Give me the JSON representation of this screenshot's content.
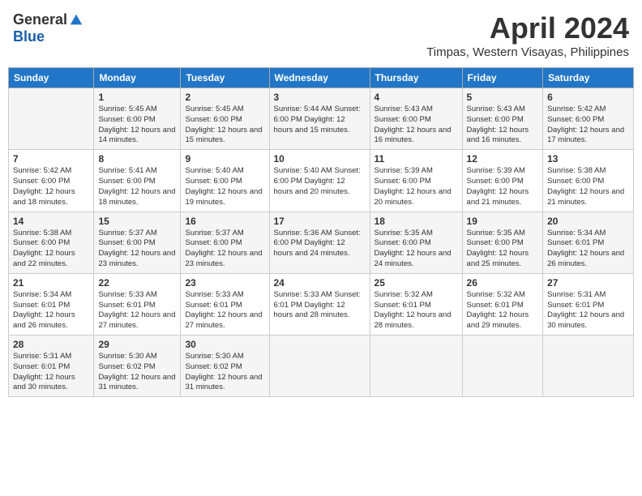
{
  "header": {
    "logo_general": "General",
    "logo_blue": "Blue",
    "title": "April 2024",
    "subtitle": "Timpas, Western Visayas, Philippines"
  },
  "days_of_week": [
    "Sunday",
    "Monday",
    "Tuesday",
    "Wednesday",
    "Thursday",
    "Friday",
    "Saturday"
  ],
  "weeks": [
    [
      {
        "day": "",
        "info": ""
      },
      {
        "day": "1",
        "info": "Sunrise: 5:45 AM\nSunset: 6:00 PM\nDaylight: 12 hours\nand 14 minutes."
      },
      {
        "day": "2",
        "info": "Sunrise: 5:45 AM\nSunset: 6:00 PM\nDaylight: 12 hours\nand 15 minutes."
      },
      {
        "day": "3",
        "info": "Sunrise: 5:44 AM\nSunset: 6:00 PM\nDaylight: 12 hours\nand 15 minutes."
      },
      {
        "day": "4",
        "info": "Sunrise: 5:43 AM\nSunset: 6:00 PM\nDaylight: 12 hours\nand 16 minutes."
      },
      {
        "day": "5",
        "info": "Sunrise: 5:43 AM\nSunset: 6:00 PM\nDaylight: 12 hours\nand 16 minutes."
      },
      {
        "day": "6",
        "info": "Sunrise: 5:42 AM\nSunset: 6:00 PM\nDaylight: 12 hours\nand 17 minutes."
      }
    ],
    [
      {
        "day": "7",
        "info": "Sunrise: 5:42 AM\nSunset: 6:00 PM\nDaylight: 12 hours\nand 18 minutes."
      },
      {
        "day": "8",
        "info": "Sunrise: 5:41 AM\nSunset: 6:00 PM\nDaylight: 12 hours\nand 18 minutes."
      },
      {
        "day": "9",
        "info": "Sunrise: 5:40 AM\nSunset: 6:00 PM\nDaylight: 12 hours\nand 19 minutes."
      },
      {
        "day": "10",
        "info": "Sunrise: 5:40 AM\nSunset: 6:00 PM\nDaylight: 12 hours\nand 20 minutes."
      },
      {
        "day": "11",
        "info": "Sunrise: 5:39 AM\nSunset: 6:00 PM\nDaylight: 12 hours\nand 20 minutes."
      },
      {
        "day": "12",
        "info": "Sunrise: 5:39 AM\nSunset: 6:00 PM\nDaylight: 12 hours\nand 21 minutes."
      },
      {
        "day": "13",
        "info": "Sunrise: 5:38 AM\nSunset: 6:00 PM\nDaylight: 12 hours\nand 21 minutes."
      }
    ],
    [
      {
        "day": "14",
        "info": "Sunrise: 5:38 AM\nSunset: 6:00 PM\nDaylight: 12 hours\nand 22 minutes."
      },
      {
        "day": "15",
        "info": "Sunrise: 5:37 AM\nSunset: 6:00 PM\nDaylight: 12 hours\nand 23 minutes."
      },
      {
        "day": "16",
        "info": "Sunrise: 5:37 AM\nSunset: 6:00 PM\nDaylight: 12 hours\nand 23 minutes."
      },
      {
        "day": "17",
        "info": "Sunrise: 5:36 AM\nSunset: 6:00 PM\nDaylight: 12 hours\nand 24 minutes."
      },
      {
        "day": "18",
        "info": "Sunrise: 5:35 AM\nSunset: 6:00 PM\nDaylight: 12 hours\nand 24 minutes."
      },
      {
        "day": "19",
        "info": "Sunrise: 5:35 AM\nSunset: 6:00 PM\nDaylight: 12 hours\nand 25 minutes."
      },
      {
        "day": "20",
        "info": "Sunrise: 5:34 AM\nSunset: 6:01 PM\nDaylight: 12 hours\nand 26 minutes."
      }
    ],
    [
      {
        "day": "21",
        "info": "Sunrise: 5:34 AM\nSunset: 6:01 PM\nDaylight: 12 hours\nand 26 minutes."
      },
      {
        "day": "22",
        "info": "Sunrise: 5:33 AM\nSunset: 6:01 PM\nDaylight: 12 hours\nand 27 minutes."
      },
      {
        "day": "23",
        "info": "Sunrise: 5:33 AM\nSunset: 6:01 PM\nDaylight: 12 hours\nand 27 minutes."
      },
      {
        "day": "24",
        "info": "Sunrise: 5:33 AM\nSunset: 6:01 PM\nDaylight: 12 hours\nand 28 minutes."
      },
      {
        "day": "25",
        "info": "Sunrise: 5:32 AM\nSunset: 6:01 PM\nDaylight: 12 hours\nand 28 minutes."
      },
      {
        "day": "26",
        "info": "Sunrise: 5:32 AM\nSunset: 6:01 PM\nDaylight: 12 hours\nand 29 minutes."
      },
      {
        "day": "27",
        "info": "Sunrise: 5:31 AM\nSunset: 6:01 PM\nDaylight: 12 hours\nand 30 minutes."
      }
    ],
    [
      {
        "day": "28",
        "info": "Sunrise: 5:31 AM\nSunset: 6:01 PM\nDaylight: 12 hours\nand 30 minutes."
      },
      {
        "day": "29",
        "info": "Sunrise: 5:30 AM\nSunset: 6:02 PM\nDaylight: 12 hours\nand 31 minutes."
      },
      {
        "day": "30",
        "info": "Sunrise: 5:30 AM\nSunset: 6:02 PM\nDaylight: 12 hours\nand 31 minutes."
      },
      {
        "day": "",
        "info": ""
      },
      {
        "day": "",
        "info": ""
      },
      {
        "day": "",
        "info": ""
      },
      {
        "day": "",
        "info": ""
      }
    ]
  ]
}
